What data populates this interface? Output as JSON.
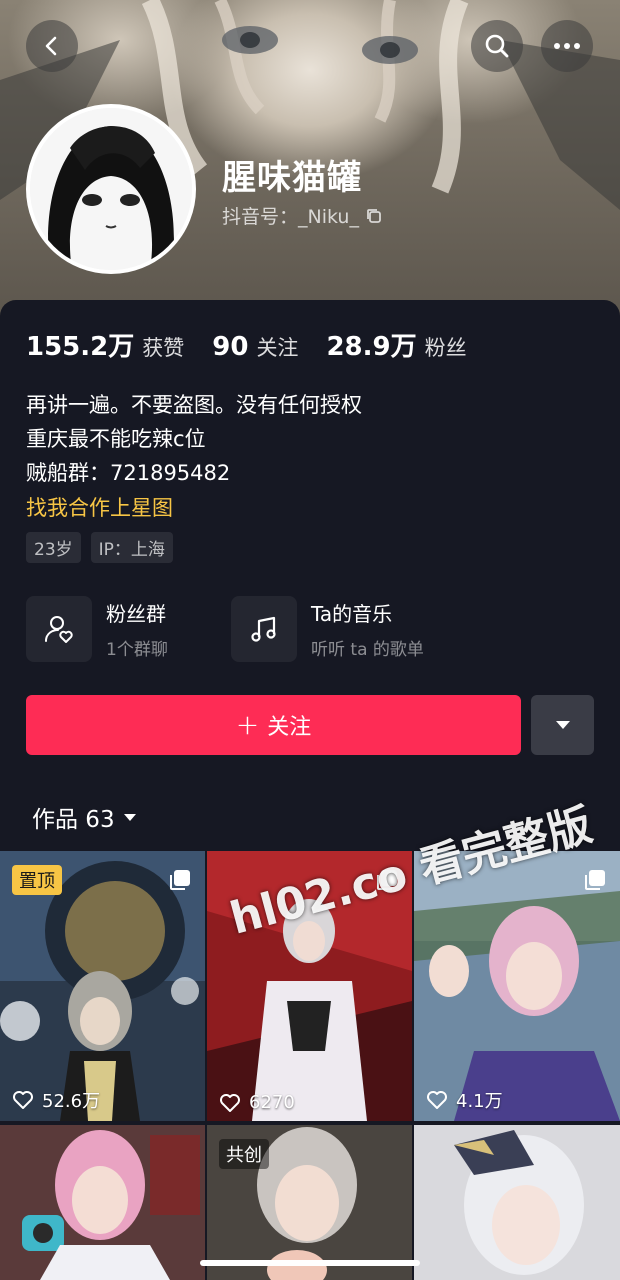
{
  "profile": {
    "nickname": "腥味猫罐",
    "douyin_id": "抖音号：_Niku_"
  },
  "stats": [
    {
      "value": "155.2万",
      "label": "获赞"
    },
    {
      "value": "90",
      "label": "关注"
    },
    {
      "value": "28.9万",
      "label": "粉丝"
    }
  ],
  "bio": {
    "lines": [
      "再讲一遍。不要盗图。没有任何授权",
      "重庆最不能吃辣c位",
      "贼船群：721895482"
    ],
    "star_link": "找我合作上星图"
  },
  "tags": [
    "23岁",
    "IP：上海"
  ],
  "features": {
    "fans_group": {
      "title": "粉丝群",
      "subtitle": "1个群聊"
    },
    "music": {
      "title": "Ta的音乐",
      "subtitle": "听听 ta 的歌单"
    }
  },
  "actions": {
    "follow_label": "关注"
  },
  "works": {
    "tab_label": "作品 63"
  },
  "grid": [
    {
      "likes": "52.6万",
      "badge": "置顶"
    },
    {
      "likes": "6270",
      "badge": ""
    },
    {
      "likes": "4.1万",
      "badge": ""
    },
    {
      "likes": "",
      "badge": ""
    },
    {
      "likes": "",
      "badge": "共创"
    },
    {
      "likes": "",
      "badge": ""
    }
  ],
  "watermark": "hl02.co 看完整版",
  "colors": {
    "accent": "#fe2c55",
    "link": "#f7c545",
    "background": "#161823"
  },
  "icons": [
    "back-arrow-icon",
    "search-icon",
    "more-icon",
    "copy-icon",
    "fans-group-icon",
    "music-note-icon",
    "caret-down-icon",
    "heart-icon",
    "multi-image-icon"
  ]
}
